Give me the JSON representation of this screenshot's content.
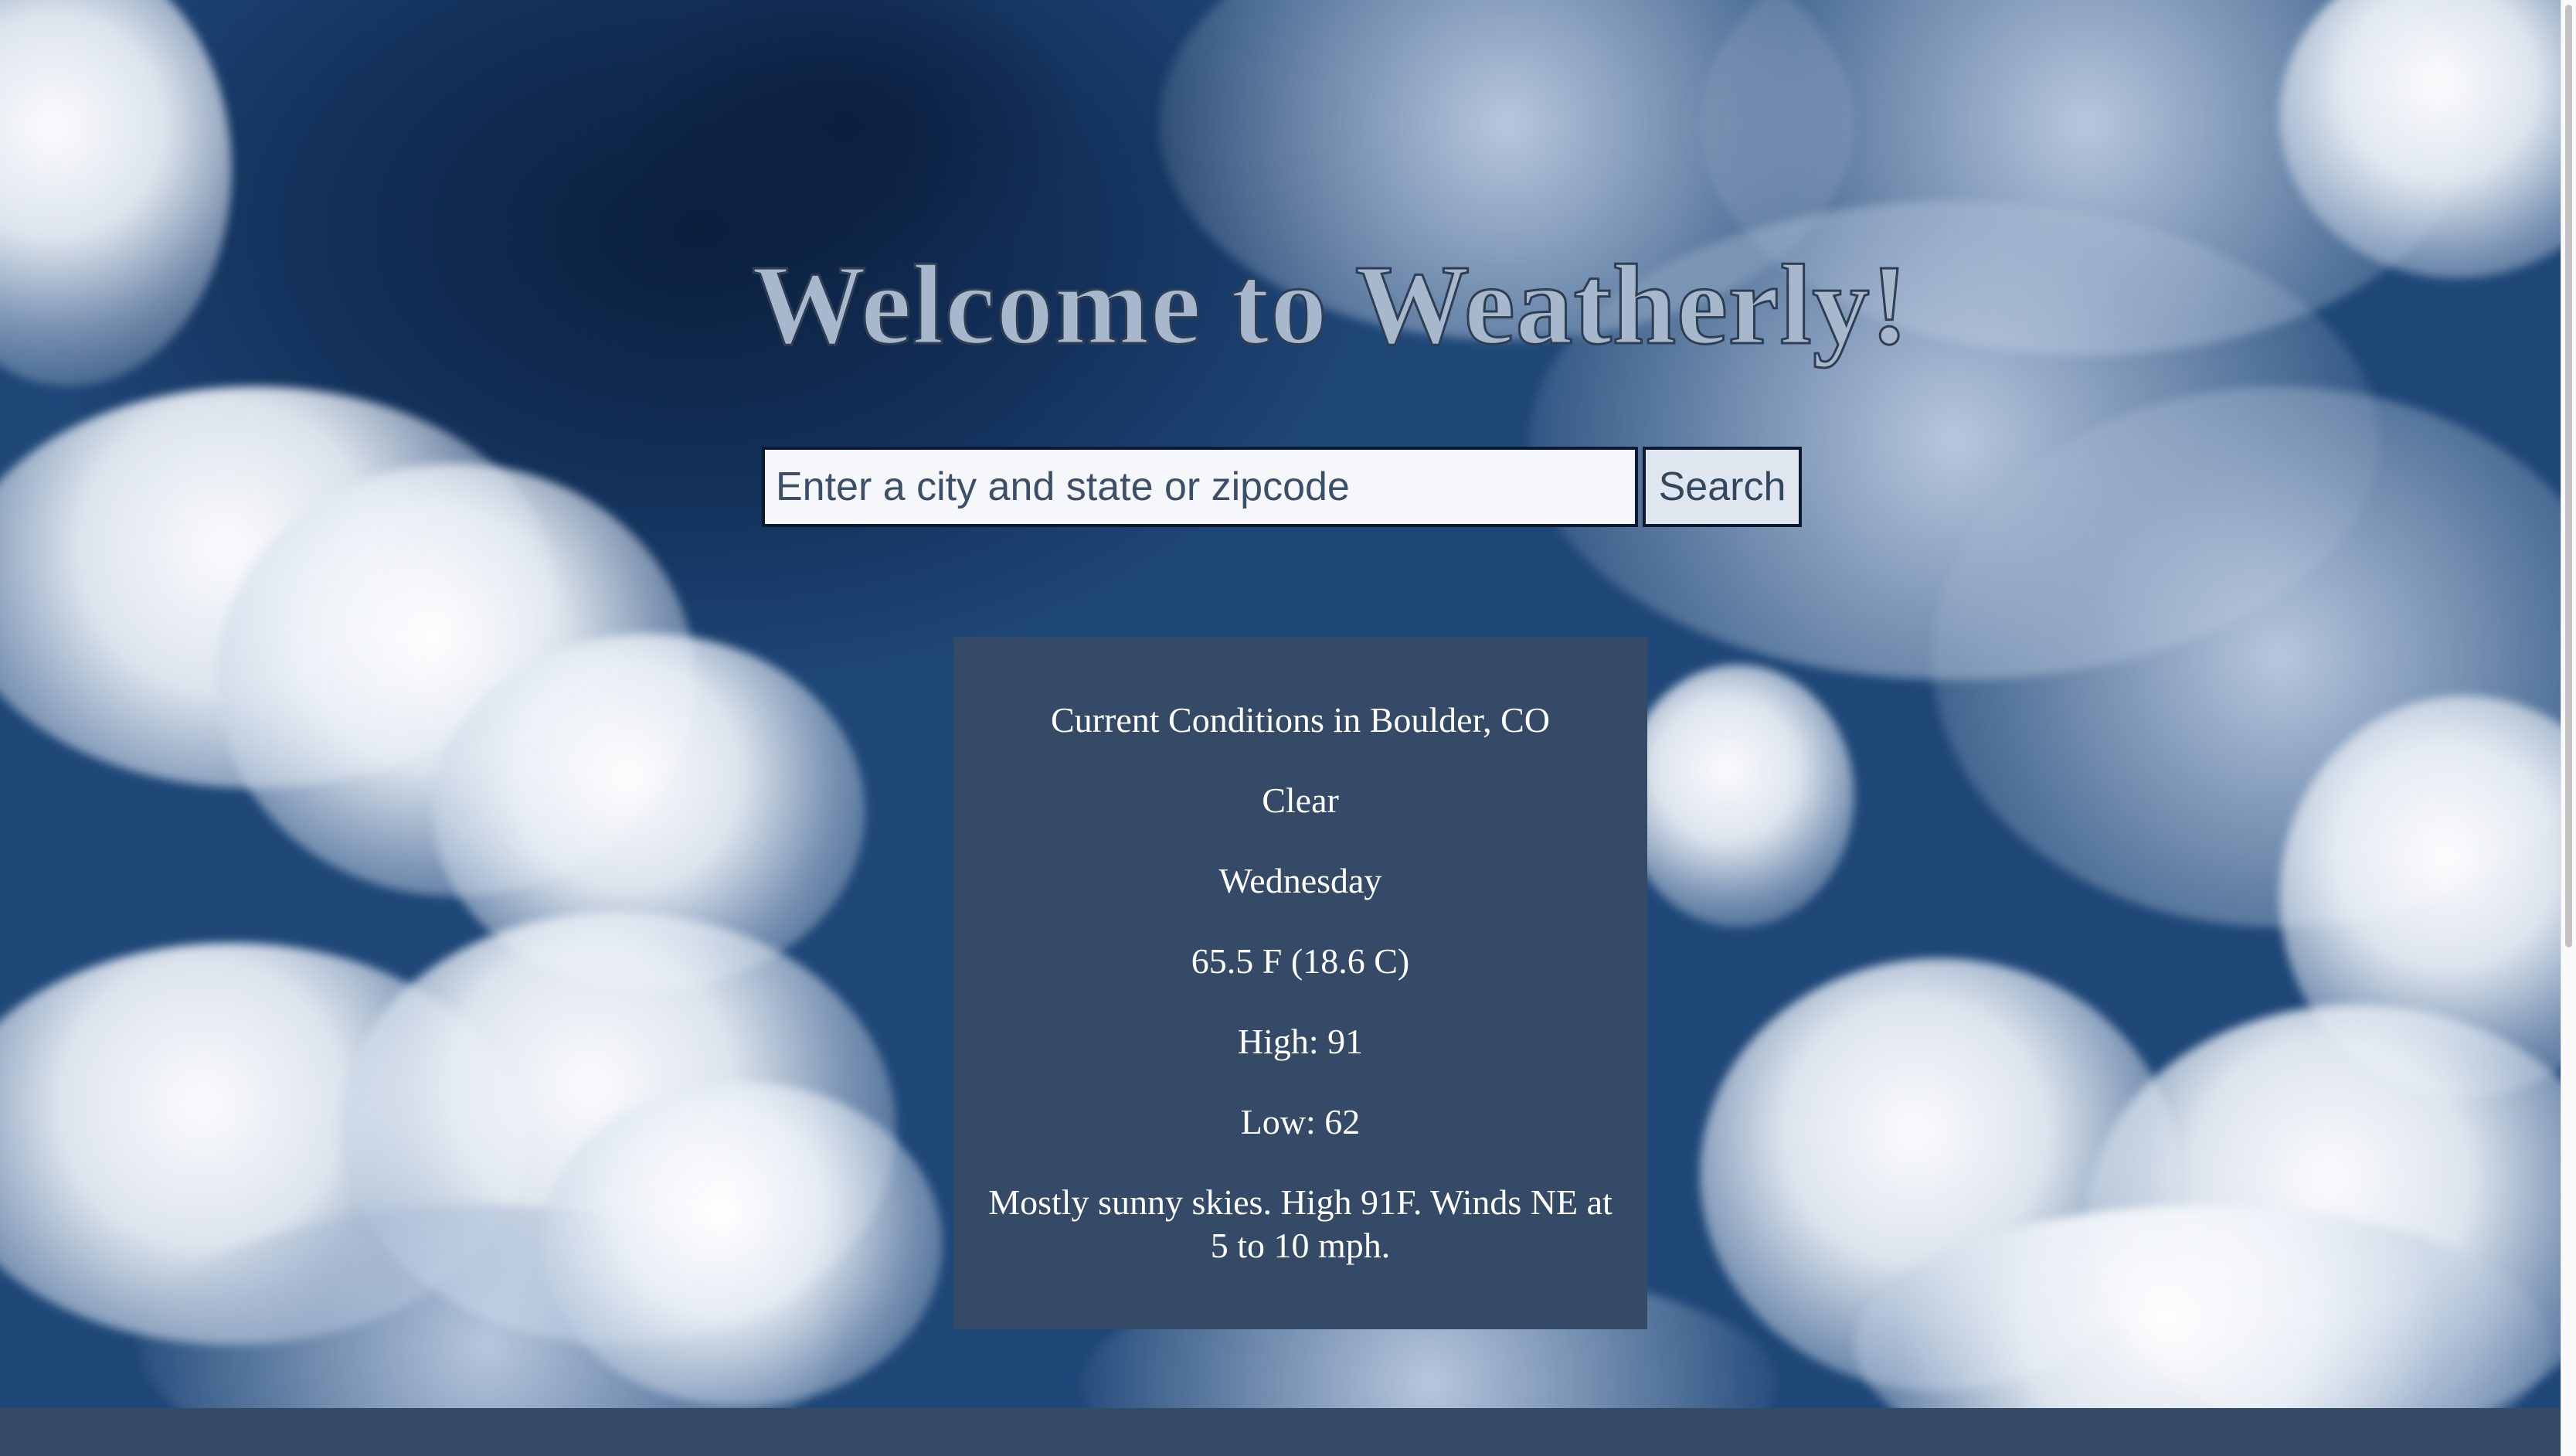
{
  "header": {
    "title": "Welcome to Weatherly!"
  },
  "search": {
    "placeholder": "Enter a city and state or zipcode",
    "value": "",
    "button_label": "Search"
  },
  "conditions": {
    "heading": "Current Conditions in Boulder, CO",
    "summary": "Clear",
    "day": "Wednesday",
    "temperature": "65.5 F (18.6 C)",
    "high": "High: 91",
    "low": "Low: 62",
    "forecast": "Mostly sunny skies. High 91F. Winds NE at 5 to 10 mph."
  },
  "colors": {
    "card_background": "#354a67",
    "footer_background": "#344a67",
    "title_fill": "#a7b7cc"
  }
}
